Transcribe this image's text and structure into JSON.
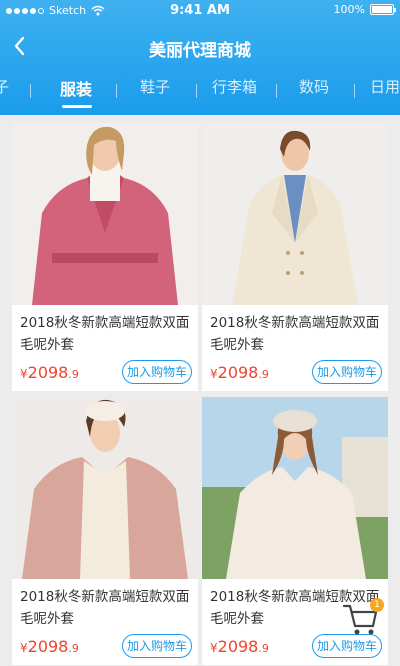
{
  "status": {
    "carrier": "Sketch",
    "time": "9:41 AM",
    "battery": "100%",
    "battery_level": 1.0
  },
  "header": {
    "title": "美丽代理商城"
  },
  "tabs": [
    {
      "label": "子"
    },
    {
      "label": "服装",
      "active": true
    },
    {
      "label": "鞋子"
    },
    {
      "label": "行李箱"
    },
    {
      "label": "数码"
    },
    {
      "label": "日用"
    }
  ],
  "products": [
    {
      "title": "2018秋冬新款高端短款双面毛呢外套",
      "price_symbol": "¥",
      "price_int": "2098",
      "price_dec": ".9",
      "cart_label": "加入购物车"
    },
    {
      "title": "2018秋冬新款高端短款双面毛呢外套",
      "price_symbol": "¥",
      "price_int": "2098",
      "price_dec": ".9",
      "cart_label": "加入购物车"
    },
    {
      "title": "2018秋冬新款高端短款双面毛呢外套",
      "price_symbol": "¥",
      "price_int": "2098",
      "price_dec": ".9",
      "cart_label": "加入购物车"
    },
    {
      "title": "2018秋冬新款高端短款双面毛呢外套",
      "price_symbol": "¥",
      "price_int": "2098",
      "price_dec": ".9",
      "cart_label": "加入购物车"
    }
  ],
  "cart": {
    "count": "1"
  },
  "colors": {
    "header": "#1a9ceb",
    "price": "#f0442d",
    "accent": "#1a9ceb",
    "badge": "#f5a623"
  },
  "icons": {
    "back": "chevron-left-icon",
    "cart": "shopping-cart-icon",
    "wifi": "wifi-icon",
    "battery": "battery-icon"
  }
}
